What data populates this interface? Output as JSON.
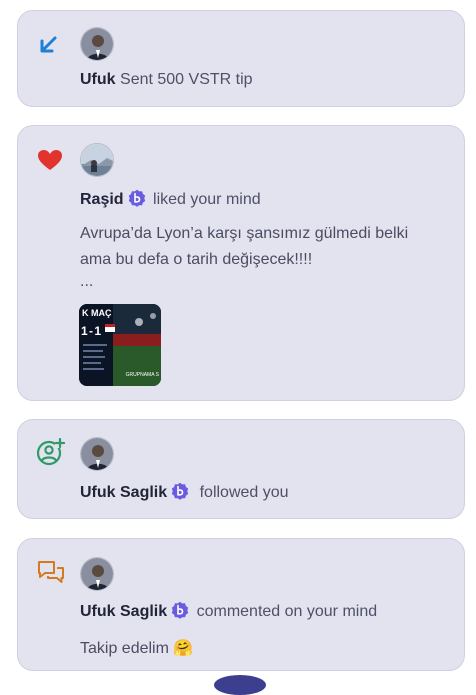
{
  "notifications": [
    {
      "type_icon": "tip-arrow-icon",
      "name": "Ufuk",
      "action": "Sent 500 VSTR tip"
    },
    {
      "type_icon": "heart-icon",
      "name": "Raşid",
      "action": "liked your mind",
      "text_line1": "Avrupa’da Lyon’a karşı şansımız gülmedi belki",
      "text_line2": "ama bu defa o tarih değişecek!!!!",
      "ellipsis": "...",
      "media_text": {
        "title": "K MAÇ",
        "score": "1 - 1",
        "footer": "GRUPNAMA S"
      }
    },
    {
      "type_icon": "follow-user-icon",
      "name": "Ufuk Saglik",
      "action": "followed you"
    },
    {
      "type_icon": "comment-icon",
      "name": "Ufuk Saglik",
      "action": "commented on your mind",
      "comment": "Takip edelim 🤗"
    }
  ],
  "colors": {
    "card_bg": "#e3e3ef",
    "tip_blue": "#1d7fd6",
    "heart_red": "#e1342f",
    "follow_green": "#2f9a67",
    "comment_orange": "#d47a1f",
    "badge_purple": "#6a5ce0"
  }
}
